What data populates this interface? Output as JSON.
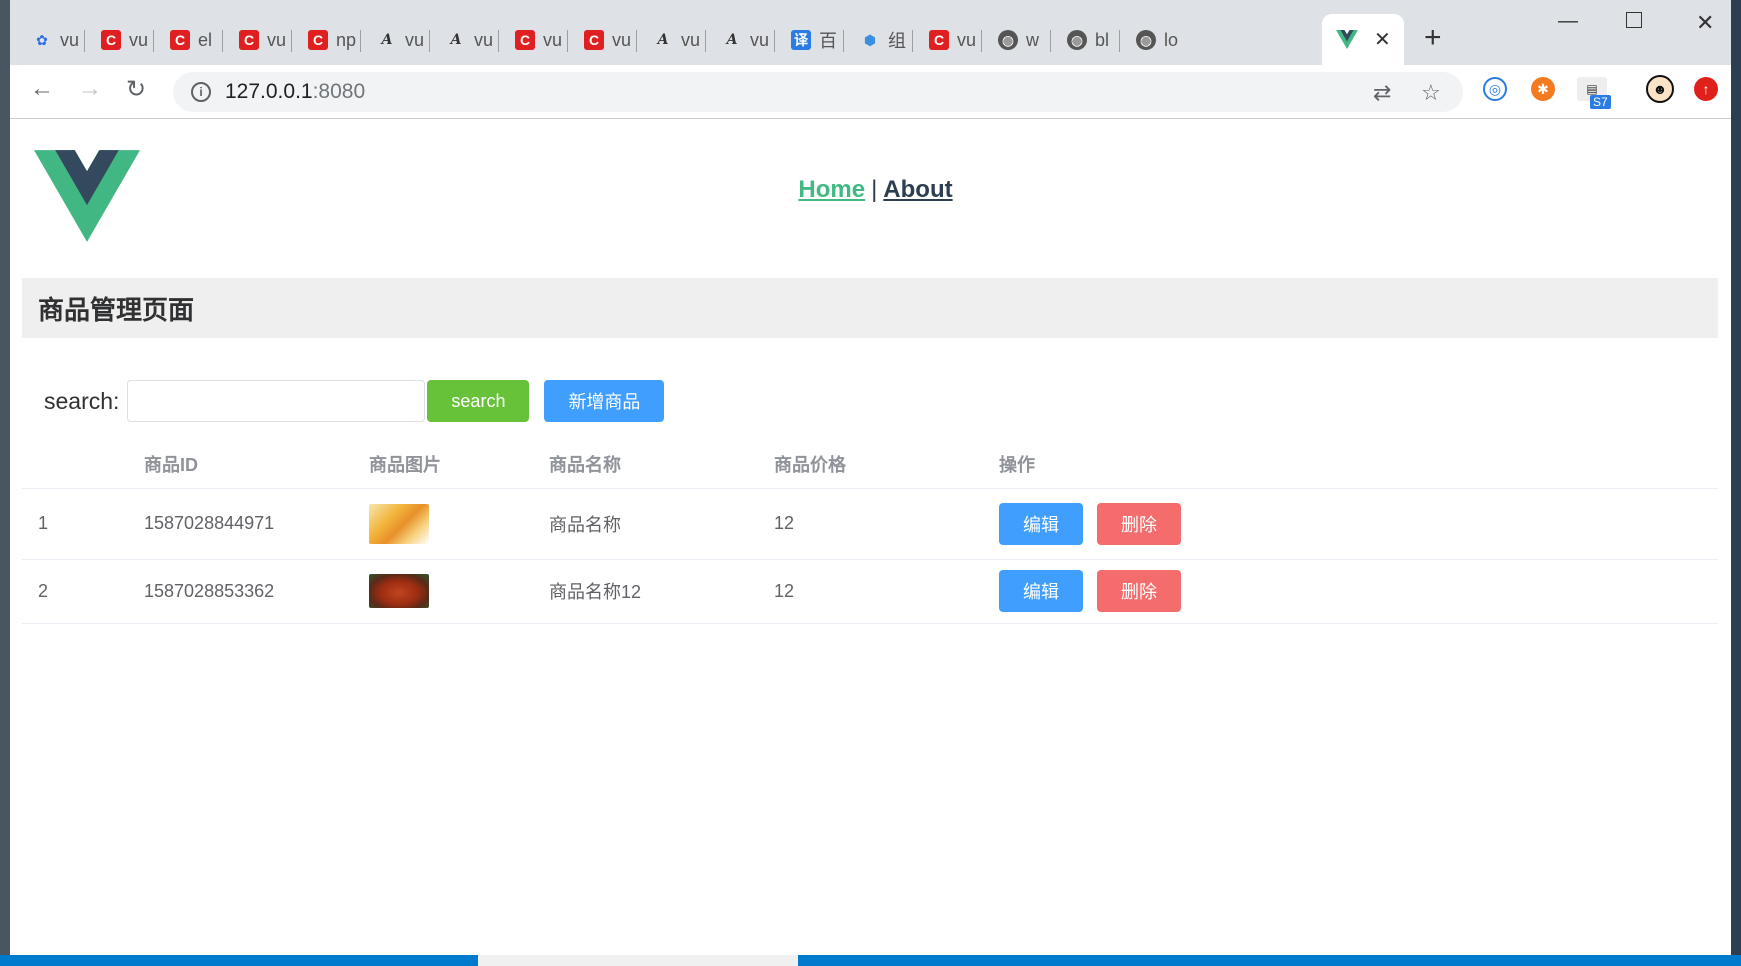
{
  "browser": {
    "tabs": [
      {
        "icon": "baidu-paw-icon",
        "title": "vu"
      },
      {
        "icon": "csdn-icon",
        "title": "vu"
      },
      {
        "icon": "csdn-icon",
        "title": "el"
      },
      {
        "icon": "csdn-icon",
        "title": "vu"
      },
      {
        "icon": "csdn-icon",
        "title": "np"
      },
      {
        "icon": "a-logo-icon",
        "title": "vu"
      },
      {
        "icon": "a-logo-icon",
        "title": "vu"
      },
      {
        "icon": "csdn-icon",
        "title": "vu"
      },
      {
        "icon": "csdn-icon",
        "title": "vu"
      },
      {
        "icon": "a-logo-icon",
        "title": "vu"
      },
      {
        "icon": "a-logo-icon",
        "title": "vu"
      },
      {
        "icon": "translate-icon",
        "title": "百"
      },
      {
        "icon": "hexagon-icon",
        "title": "组"
      },
      {
        "icon": "csdn-icon",
        "title": "vu"
      },
      {
        "icon": "globe-icon",
        "title": "w"
      },
      {
        "icon": "globe-icon",
        "title": "bl"
      },
      {
        "icon": "globe-icon",
        "title": "lo"
      }
    ],
    "url_host": "127.0.0.1",
    "url_port": ":8080",
    "ext_badge": "S7"
  },
  "nav": {
    "home": "Home",
    "separator": "|",
    "about": "About"
  },
  "page": {
    "title": "商品管理页面",
    "search_label": "search:",
    "search_value": "",
    "search_button": "search",
    "add_button": "新增商品"
  },
  "table": {
    "headers": [
      "",
      "商品ID",
      "商品图片",
      "商品名称",
      "商品价格",
      "操作"
    ],
    "rows": [
      {
        "index": "1",
        "id": "1587028844971",
        "name": "商品名称",
        "price": "12",
        "edit": "编辑",
        "delete": "删除"
      },
      {
        "index": "2",
        "id": "1587028853362",
        "name": "商品名称12",
        "price": "12",
        "edit": "编辑",
        "delete": "删除"
      }
    ]
  },
  "colors": {
    "vue_green": "#42b983",
    "vue_dark": "#35495e",
    "primary": "#409eff",
    "success": "#67c23a",
    "danger": "#f56c6c"
  }
}
